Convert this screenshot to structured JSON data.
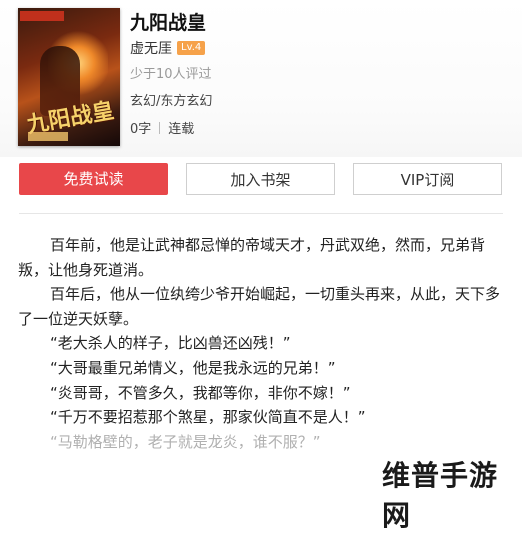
{
  "book": {
    "title": "九阳战皇",
    "author": "虚无厓",
    "level": "Lv.4",
    "reviews": "少于10人评过",
    "genre": "玄幻/东方玄幻",
    "word_count": "0字",
    "status": "连载",
    "cover_title": "九阳战皇"
  },
  "actions": {
    "read": "免费试读",
    "shelf": "加入书架",
    "vip": "VIP订阅"
  },
  "synopsis": [
    "百年前，他是让武神都忌惮的帝域天才，丹武双绝，然而，兄弟背叛，让他身死道消。",
    "百年后，他从一位纨绔少爷开始崛起，一切重头再来，从此，天下多了一位逆天妖孽。",
    "“老大杀人的样子，比凶兽还凶残！”",
    "“大哥最重兄弟情义，他是我永远的兄弟！”",
    "“炎哥哥，不管多久，我都等你，非你不嫁！”",
    "“千万不要招惹那个煞星，那家伙简直不是人！”",
    "“马勒格壁的，老子就是龙炎，谁不服？”"
  ],
  "watermark": "维普手游网",
  "colors": {
    "accent": "#e8474a",
    "badge": "#f6a24a"
  }
}
